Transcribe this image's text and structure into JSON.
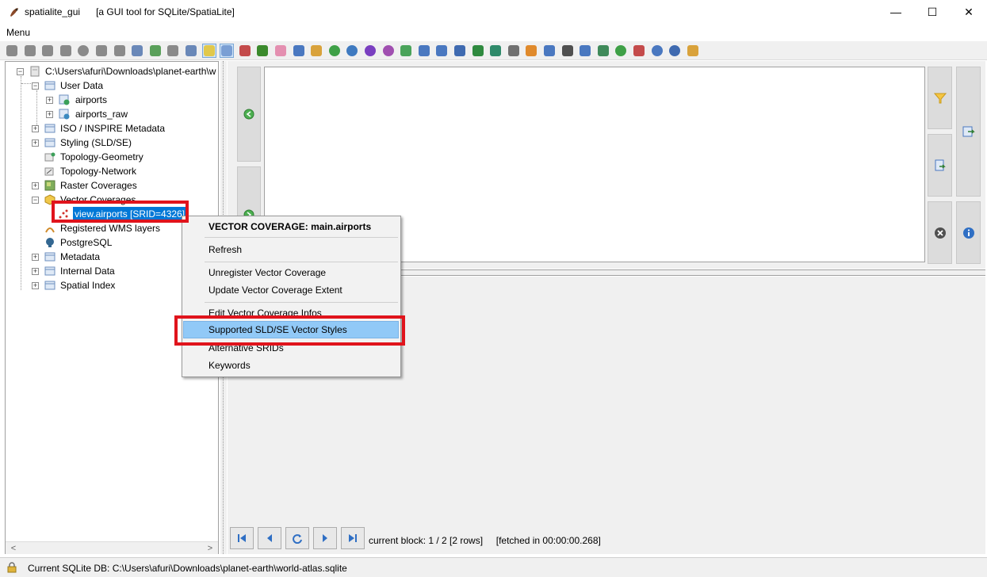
{
  "window": {
    "app_name": "spatialite_gui",
    "subtitle": "[a GUI tool for SQLite/SpatiaLite]",
    "minimize": "—",
    "maximize": "☐",
    "close": "✕"
  },
  "menu": {
    "label": "Menu"
  },
  "toolbar": {
    "icons": [
      {
        "name": "connect-icon",
        "color": "#8a8a8a"
      },
      {
        "name": "create-db-icon",
        "color": "#8a8a8a"
      },
      {
        "name": "memory-db-icon",
        "color": "#8a8a8a"
      },
      {
        "name": "disconnect-icon",
        "color": "#8a8a8a"
      },
      {
        "name": "vacuum-icon",
        "color": "#8a8a8a"
      },
      {
        "name": "sql-script-icon",
        "color": "#8a8a8a"
      },
      {
        "name": "load-shp-icon",
        "color": "#8a8a8a"
      },
      {
        "name": "virtual-shp-icon",
        "color": "#6a88b8"
      },
      {
        "name": "refresh-icon",
        "color": "#5aa05a"
      },
      {
        "name": "save-icon",
        "color": "#8a8a8a"
      },
      {
        "name": "network-icon",
        "color": "#6a88b8"
      },
      {
        "name": "query-view-icon",
        "color": "#e1c84b"
      },
      {
        "name": "composer-icon",
        "color": "#7a9fd4"
      },
      {
        "name": "chart-icon",
        "color": "#c44b4b"
      },
      {
        "name": "bug-icon",
        "color": "#3b8a2c"
      },
      {
        "name": "flower-icon",
        "color": "#e48fb0"
      },
      {
        "name": "import-icon",
        "color": "#4a78c0"
      },
      {
        "name": "export-icon",
        "color": "#d9a23b"
      },
      {
        "name": "globe-green-icon",
        "color": "#3fa047"
      },
      {
        "name": "globe-blue-icon",
        "color": "#3f7ac0"
      },
      {
        "name": "globe-purple-icon",
        "color": "#7a3fc0"
      },
      {
        "name": "globe-violet-icon",
        "color": "#a04fb0"
      },
      {
        "name": "doc-green-icon",
        "color": "#4aa35a"
      },
      {
        "name": "doc-blue-icon",
        "color": "#4a78c0"
      },
      {
        "name": "doc-grid-icon",
        "color": "#4a78c0"
      },
      {
        "name": "doc-table-icon",
        "color": "#3f6ab0"
      },
      {
        "name": "excel-icon",
        "color": "#2f8a3f"
      },
      {
        "name": "doc-export-icon",
        "color": "#2f8a6a"
      },
      {
        "name": "eye-icon",
        "color": "#707070"
      },
      {
        "name": "layers-icon",
        "color": "#e08a2c"
      },
      {
        "name": "copy-icon",
        "color": "#4a78c0"
      },
      {
        "name": "list-icon",
        "color": "#505050"
      },
      {
        "name": "wifi-icon",
        "color": "#4a78c0"
      },
      {
        "name": "graph-icon",
        "color": "#3f8a5a"
      },
      {
        "name": "globe-refresh-icon",
        "color": "#3fa047"
      },
      {
        "name": "font-icon",
        "color": "#c44b4b"
      },
      {
        "name": "info-icon",
        "color": "#4a78c0"
      },
      {
        "name": "help-icon",
        "color": "#3f6ab0"
      },
      {
        "name": "exit-icon",
        "color": "#d9a23b"
      }
    ]
  },
  "tree": {
    "root": "C:\\Users\\afuri\\Downloads\\planet-earth\\w",
    "items": [
      {
        "label": "User Data"
      },
      {
        "label": "airports"
      },
      {
        "label": "airports_raw"
      },
      {
        "label": "ISO / INSPIRE Metadata"
      },
      {
        "label": "Styling (SLD/SE)"
      },
      {
        "label": "Topology-Geometry"
      },
      {
        "label": "Topology-Network"
      },
      {
        "label": "Raster Coverages"
      },
      {
        "label": "Vector Coverages"
      },
      {
        "label": "view.airports [SRID=4326]"
      },
      {
        "label": "Registered WMS layers"
      },
      {
        "label": "PostgreSQL"
      },
      {
        "label": "Metadata"
      },
      {
        "label": "Internal Data"
      },
      {
        "label": "Spatial Index"
      }
    ],
    "scroll_left": "<",
    "scroll_right": ">"
  },
  "context_menu": {
    "header": "VECTOR COVERAGE: main.airports",
    "items": [
      "Refresh",
      "Unregister Vector Coverage",
      "Update Vector Coverage Extent",
      "Edit Vector Coverage Infos",
      "Supported SLD/SE Vector Styles",
      "Alternative SRIDs",
      "Keywords"
    ],
    "highlight_color": "#91c9f7"
  },
  "results": {
    "block_info": "current block: 1 / 2 [2 rows]     [fetched in 00:00:00.268]"
  },
  "status": {
    "text": "Current SQLite DB: C:\\Users\\afuri\\Downloads\\planet-earth\\world-atlas.sqlite"
  },
  "accent": {
    "annotation_red": "#e0141c"
  }
}
